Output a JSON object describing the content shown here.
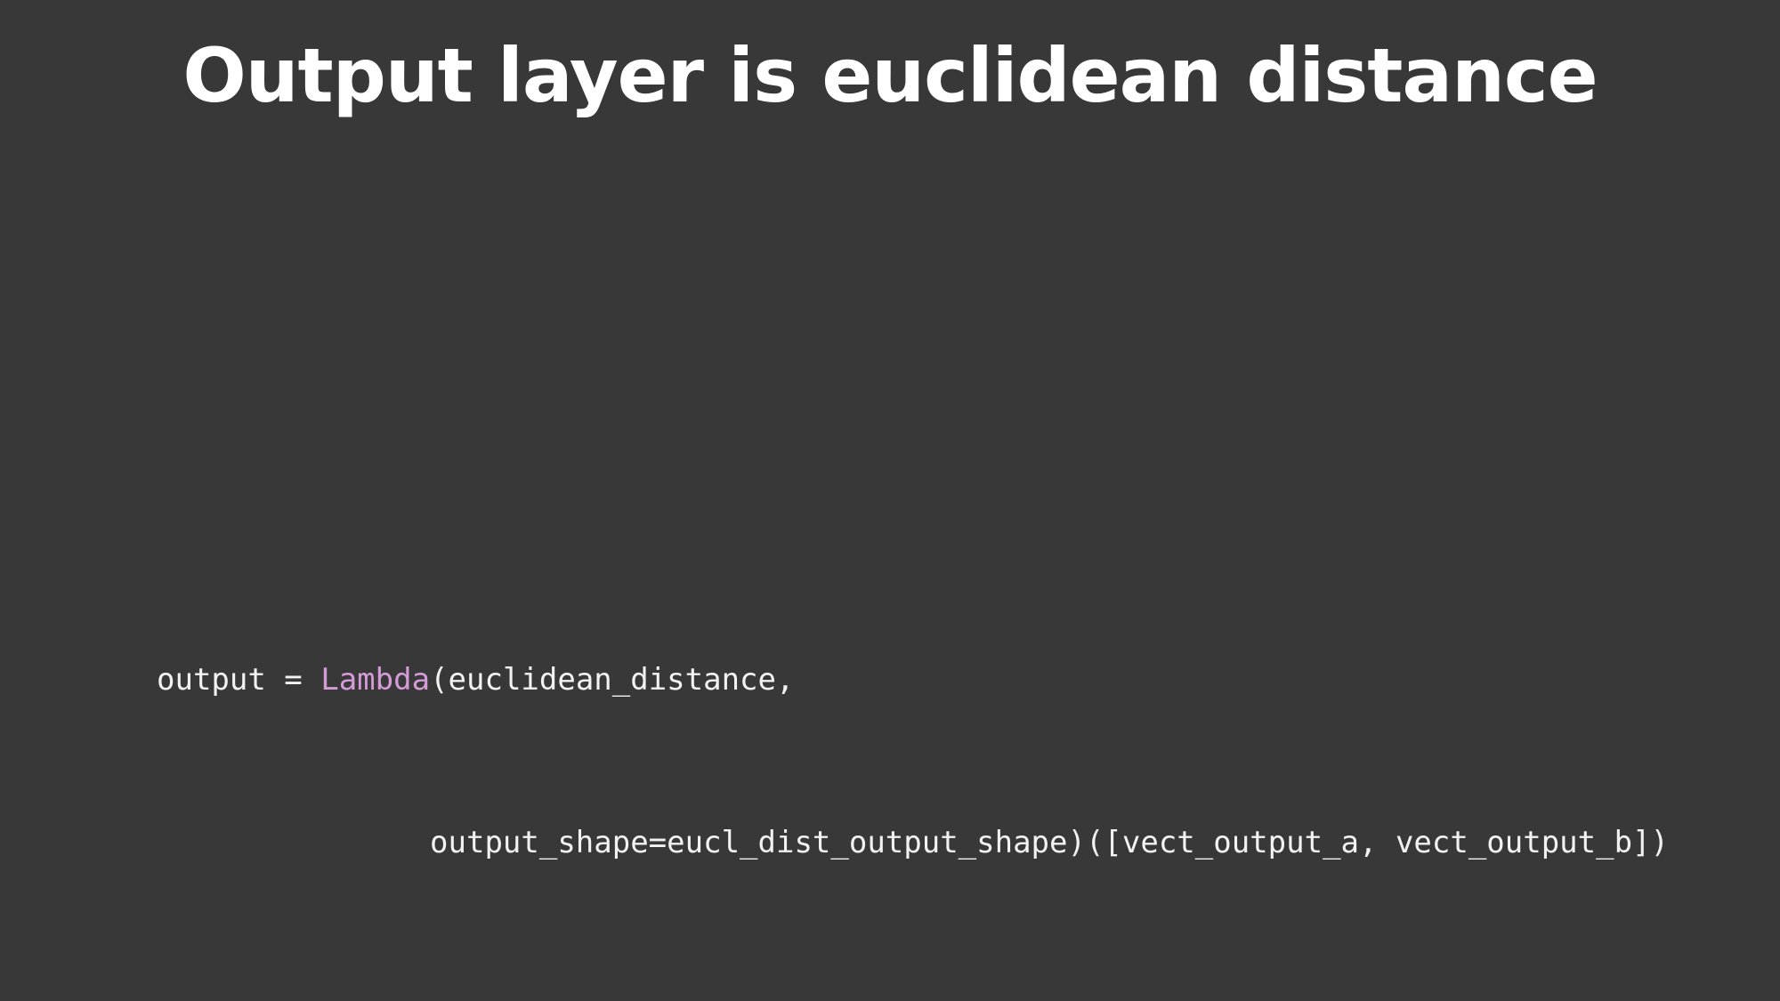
{
  "slide": {
    "title": "Output layer is euclidean distance"
  },
  "code": {
    "line1_prefix": "output = ",
    "line1_function": "Lambda",
    "line1_suffix": "(euclidean_distance,",
    "line2_indent": "               ",
    "line2_text": "output_shape=eucl_dist_output_shape)([vect_output_a, vect_output_b])"
  },
  "colors": {
    "background": "#383838",
    "text": "#f2f2f2",
    "function_highlight": "#d59bd8"
  }
}
